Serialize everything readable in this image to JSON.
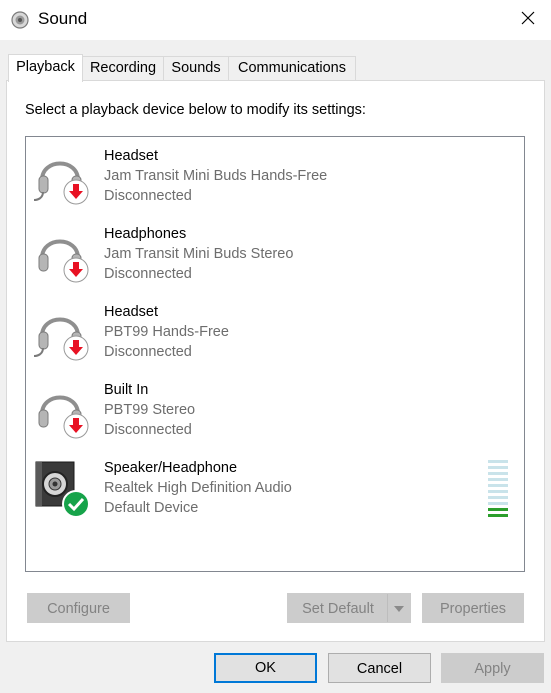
{
  "window": {
    "title": "Sound",
    "icon": "speaker-icon"
  },
  "tabs": [
    {
      "label": "Playback",
      "active": true
    },
    {
      "label": "Recording",
      "active": false
    },
    {
      "label": "Sounds",
      "active": false
    },
    {
      "label": "Communications",
      "active": false
    }
  ],
  "playback": {
    "instruction": "Select a playback device below to modify its settings:",
    "devices": [
      {
        "name": "Headset",
        "description": "Jam Transit Mini Buds Hands-Free",
        "status": "Disconnected",
        "icon": "headset-icon",
        "status_icon": "disconnected-arrow-icon"
      },
      {
        "name": "Headphones",
        "description": "Jam Transit Mini Buds Stereo",
        "status": "Disconnected",
        "icon": "headphones-icon",
        "status_icon": "disconnected-arrow-icon"
      },
      {
        "name": "Headset",
        "description": "PBT99 Hands-Free",
        "status": "Disconnected",
        "icon": "headset-icon",
        "status_icon": "disconnected-arrow-icon"
      },
      {
        "name": "Built In",
        "description": "PBT99 Stereo",
        "status": "Disconnected",
        "icon": "headphones-icon",
        "status_icon": "disconnected-arrow-icon"
      },
      {
        "name": "Speaker/Headphone",
        "description": "Realtek High Definition Audio",
        "status": "Default Device",
        "icon": "speaker-icon",
        "status_icon": "default-check-icon"
      }
    ],
    "level_meter": {
      "segments": 10,
      "lit_segments": 2,
      "lit_color": "#2b9e2b",
      "unlit_color": "#c9e3ea"
    }
  },
  "buttons": {
    "configure": "Configure",
    "set_default": "Set Default",
    "properties": "Properties",
    "ok": "OK",
    "cancel": "Cancel",
    "apply": "Apply"
  },
  "colors": {
    "accent": "#0078d7",
    "disconnected": "#e81123",
    "default_ok": "#16a34a"
  }
}
